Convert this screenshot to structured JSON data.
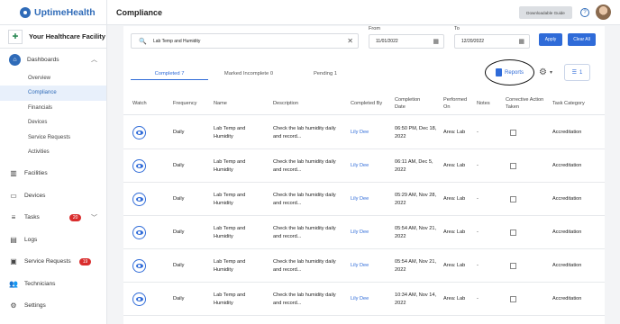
{
  "app": {
    "brand": "UptimeHealth",
    "facility": "Your Healthcare Facility",
    "page_title": "Compliance",
    "downloadable_guide": "Downloadable Guide"
  },
  "sidebar": {
    "dashboards": "Dashboards",
    "sub_items": [
      "Overview",
      "Compliance",
      "Financials",
      "Devices",
      "Service Requests",
      "Activities"
    ],
    "facilities": "Facilities",
    "devices": "Devices",
    "tasks": "Tasks",
    "tasks_badge": "20",
    "logs": "Logs",
    "service_requests": "Service Requests",
    "service_requests_badge": "19",
    "technicians": "Technicians",
    "settings": "Settings"
  },
  "filters": {
    "search_value": "Lab Temp and Humidity",
    "from_label": "From",
    "from_value": "11/01/2022",
    "to_label": "To",
    "to_value": "12/20/2022",
    "apply": "Apply",
    "clear_all": "Clear All"
  },
  "tabs": {
    "completed": "Completed 7",
    "marked_incomplete": "Marked Incomplete 0",
    "pending": "Pending 1"
  },
  "toolbar": {
    "reports": "Reports",
    "filter_count": "1"
  },
  "table": {
    "headers": {
      "watch": "Watch",
      "frequency": "Frequency",
      "name": "Name",
      "description": "Description",
      "completed_by": "Completed By",
      "completion_date": "Completion Date",
      "performed_on": "Performed On",
      "notes": "Notes",
      "corrective": "Corrective Action Taken",
      "task_category": "Task Category"
    },
    "rows": [
      {
        "frequency": "Daily",
        "name": "Lab Temp and Humidity",
        "description": "Check the lab humidity daily and record...",
        "completed_by": "Lily Dee",
        "completion_date": "06:50 PM, Dec 18, 2022",
        "performed_on": "Area: Lab",
        "notes": "-",
        "task_category": "Accreditation"
      },
      {
        "frequency": "Daily",
        "name": "Lab Temp and Humidity",
        "description": "Check the lab humidity daily and record...",
        "completed_by": "Lily Dee",
        "completion_date": "06:11 AM, Dec 5, 2022",
        "performed_on": "Area: Lab",
        "notes": "-",
        "task_category": "Accreditation"
      },
      {
        "frequency": "Daily",
        "name": "Lab Temp and Humidity",
        "description": "Check the lab humidity daily and record...",
        "completed_by": "Lily Dee",
        "completion_date": "05:29 AM, Nov 28, 2022",
        "performed_on": "Area: Lab",
        "notes": "-",
        "task_category": "Accreditation"
      },
      {
        "frequency": "Daily",
        "name": "Lab Temp and Humidity",
        "description": "Check the lab humidity daily and record...",
        "completed_by": "Lily Dee",
        "completion_date": "05:54 AM, Nov 21, 2022",
        "performed_on": "Area: Lab",
        "notes": "-",
        "task_category": "Accreditation"
      },
      {
        "frequency": "Daily",
        "name": "Lab Temp and Humidity",
        "description": "Check the lab humidity daily and record...",
        "completed_by": "Lily Dee",
        "completion_date": "05:54 AM, Nov 21, 2022",
        "performed_on": "Area: Lab",
        "notes": "-",
        "task_category": "Accreditation"
      },
      {
        "frequency": "Daily",
        "name": "Lab Temp and Humidity",
        "description": "Check the lab humidity daily and record...",
        "completed_by": "Lily Dee",
        "completion_date": "10:34 AM, Nov 14, 2022",
        "performed_on": "Area: Lab",
        "notes": "-",
        "task_category": "Accreditation"
      }
    ]
  },
  "colors": {
    "accent": "#2f6bd8",
    "brand": "#2f6bb8",
    "badge": "#d92d2d"
  }
}
